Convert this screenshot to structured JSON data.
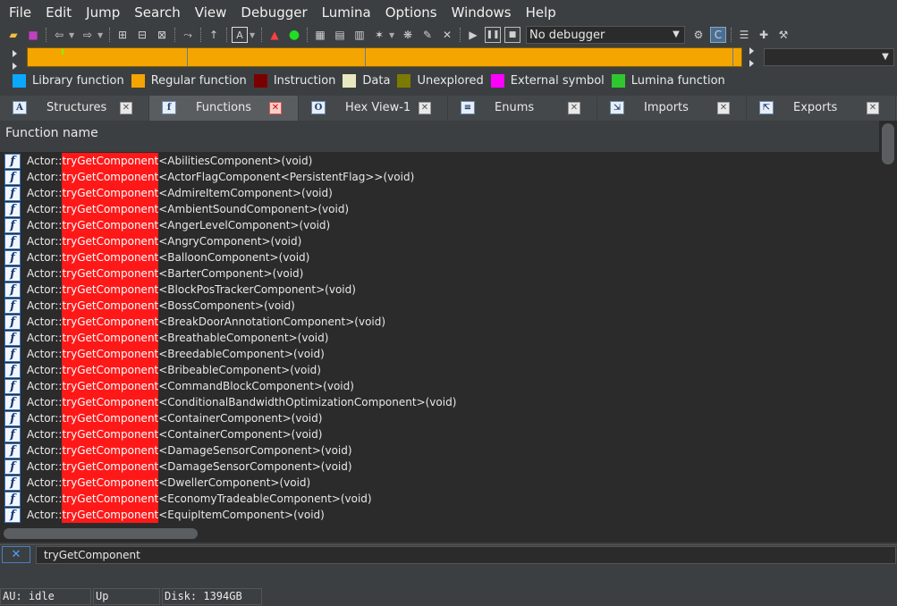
{
  "menu": [
    "File",
    "Edit",
    "Jump",
    "Search",
    "View",
    "Debugger",
    "Lumina",
    "Options",
    "Windows",
    "Help"
  ],
  "toolbar": {
    "debugger_value": "No debugger"
  },
  "legend": [
    {
      "label": "Library function",
      "color": "#0aa8ff"
    },
    {
      "label": "Regular function",
      "color": "#f5a500"
    },
    {
      "label": "Instruction",
      "color": "#7a0000"
    },
    {
      "label": "Data",
      "color": "#e8e8c0"
    },
    {
      "label": "Unexplored",
      "color": "#7d7a00"
    },
    {
      "label": "External symbol",
      "color": "#ff00ff"
    },
    {
      "label": "Lumina function",
      "color": "#2ec82e"
    }
  ],
  "tabs": [
    {
      "label": "Structures",
      "icon": "A",
      "active": false
    },
    {
      "label": "Functions",
      "icon": "f",
      "active": true
    },
    {
      "label": "Hex View-1",
      "icon": "O",
      "active": false
    },
    {
      "label": "Enums",
      "icon": "≡",
      "active": false
    },
    {
      "label": "Imports",
      "icon": "⇲",
      "active": false
    },
    {
      "label": "Exports",
      "icon": "⇱",
      "active": false
    }
  ],
  "list": {
    "header": "Function name",
    "prefix": "Actor::",
    "highlight": "tryGetComponent",
    "rows": [
      "<AbilitiesComponent>(void)",
      "<ActorFlagComponent<PersistentFlag>>(void)",
      "<AdmireItemComponent>(void)",
      "<AmbientSoundComponent>(void)",
      "<AngerLevelComponent>(void)",
      "<AngryComponent>(void)",
      "<BalloonComponent>(void)",
      "<BarterComponent>(void)",
      "<BlockPosTrackerComponent>(void)",
      "<BossComponent>(void)",
      "<BreakDoorAnnotationComponent>(void)",
      "<BreathableComponent>(void)",
      "<BreedableComponent>(void)",
      "<BribeableComponent>(void)",
      "<CommandBlockComponent>(void)",
      "<ConditionalBandwidthOptimizationComponent>(void)",
      "<ContainerComponent>(void)",
      "<ContainerComponent>(void)",
      "<DamageSensorComponent>(void)",
      "<DamageSensorComponent>(void)",
      "<DwellerComponent>(void)",
      "<EconomyTradeableComponent>(void)",
      "<EquipItemComponent>(void)"
    ]
  },
  "search": {
    "close_label": "✕",
    "value": "tryGetComponent"
  },
  "status": {
    "au": "AU:  idle",
    "direction": "Up",
    "disk": "Disk: 1394GB"
  }
}
